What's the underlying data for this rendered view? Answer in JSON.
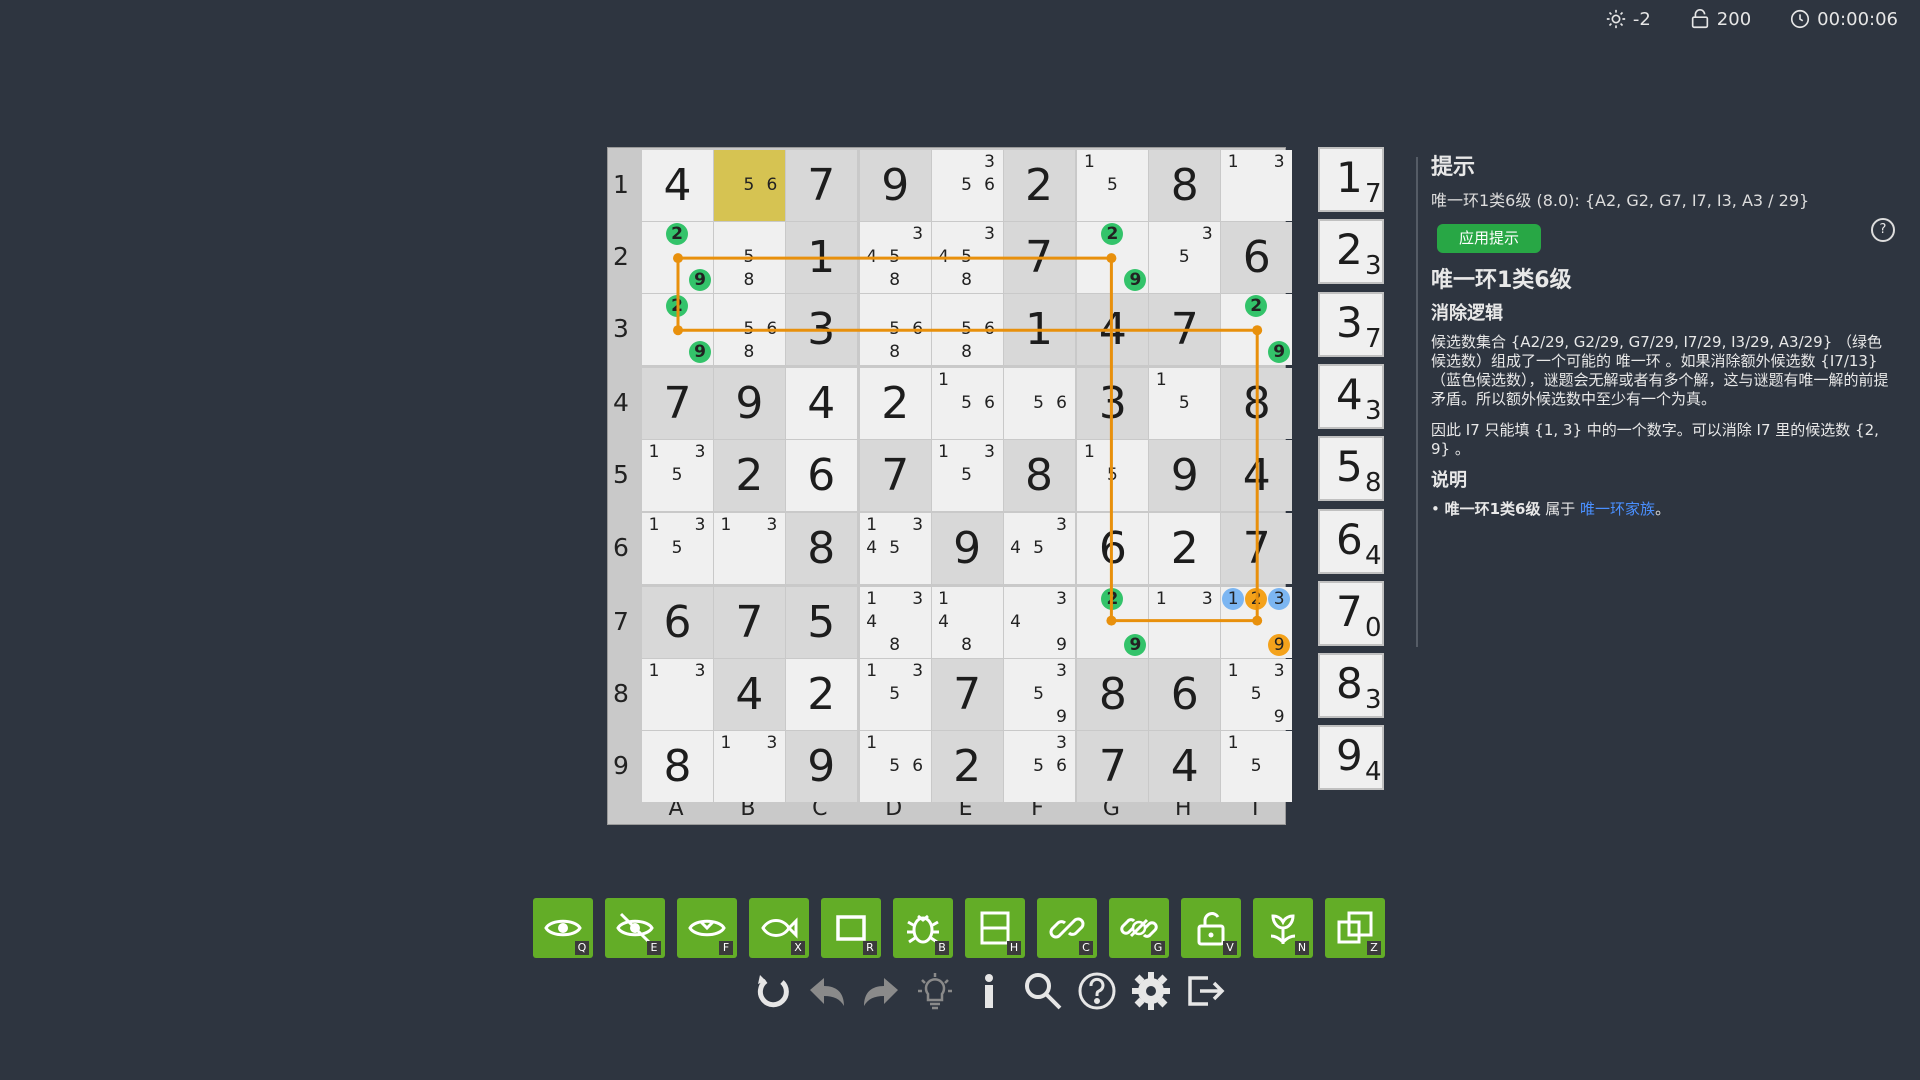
{
  "status": {
    "light": "-2",
    "score": "200",
    "time": "00:00:06"
  },
  "board": {
    "row_labels": [
      "1",
      "2",
      "3",
      "4",
      "5",
      "6",
      "7",
      "8",
      "9"
    ],
    "col_labels": [
      "A",
      "B",
      "C",
      "D",
      "E",
      "F",
      "G",
      "H",
      "I"
    ],
    "highlight": "B1",
    "cells": {
      "A1": {
        "v": "4",
        "g": 0
      },
      "B1": {
        "c": [
          "5",
          "6"
        ]
      },
      "C1": {
        "v": "7",
        "g": 1
      },
      "D1": {
        "v": "9",
        "g": 1
      },
      "E1": {
        "c": [
          "3",
          "5",
          "6"
        ]
      },
      "F1": {
        "v": "2",
        "g": 1
      },
      "G1": {
        "c": [
          "1",
          "5"
        ]
      },
      "H1": {
        "v": "8",
        "g": 1
      },
      "I1": {
        "c": [
          "1",
          "3"
        ]
      },
      "A2": {
        "c": [
          "2",
          "9"
        ],
        "green": [
          "2",
          "9"
        ]
      },
      "B2": {
        "c": [
          "5",
          "8"
        ]
      },
      "C2": {
        "v": "1",
        "g": 1
      },
      "D2": {
        "c": [
          "3",
          "4",
          "5",
          "8"
        ]
      },
      "E2": {
        "c": [
          "3",
          "4",
          "5",
          "8"
        ]
      },
      "F2": {
        "v": "7",
        "g": 1
      },
      "G2": {
        "c": [
          "2",
          "9"
        ],
        "green": [
          "2",
          "9"
        ]
      },
      "H2": {
        "c": [
          "3",
          "5"
        ]
      },
      "I2": {
        "v": "6",
        "g": 1
      },
      "A3": {
        "c": [
          "2",
          "9"
        ],
        "green": [
          "2",
          "9"
        ]
      },
      "B3": {
        "c": [
          "5",
          "6",
          "8"
        ]
      },
      "C3": {
        "v": "3",
        "g": 1
      },
      "D3": {
        "c": [
          "5",
          "6",
          "8"
        ]
      },
      "E3": {
        "c": [
          "5",
          "6",
          "8"
        ]
      },
      "F3": {
        "v": "1",
        "g": 1
      },
      "G3": {
        "v": "4",
        "g": 1
      },
      "H3": {
        "v": "7",
        "g": 1
      },
      "I3": {
        "c": [
          "2",
          "9"
        ],
        "green": [
          "2",
          "9"
        ]
      },
      "A4": {
        "v": "7",
        "g": 1
      },
      "B4": {
        "v": "9",
        "g": 1
      },
      "C4": {
        "v": "4",
        "g": 0
      },
      "D4": {
        "v": "2",
        "g": 0
      },
      "E4": {
        "c": [
          "1",
          "5",
          "6"
        ]
      },
      "F4": {
        "c": [
          "5",
          "6"
        ]
      },
      "G4": {
        "v": "3",
        "g": 1
      },
      "H4": {
        "c": [
          "1",
          "5"
        ]
      },
      "I4": {
        "v": "8",
        "g": 1
      },
      "A5": {
        "c": [
          "1",
          "3",
          "5"
        ]
      },
      "B5": {
        "v": "2",
        "g": 1
      },
      "C5": {
        "v": "6",
        "g": 0
      },
      "D5": {
        "v": "7",
        "g": 1
      },
      "E5": {
        "c": [
          "1",
          "3",
          "5"
        ]
      },
      "F5": {
        "v": "8",
        "g": 1
      },
      "G5": {
        "c": [
          "1",
          "5"
        ]
      },
      "H5": {
        "v": "9",
        "g": 1
      },
      "I5": {
        "v": "4",
        "g": 1
      },
      "A6": {
        "c": [
          "1",
          "3",
          "5"
        ]
      },
      "B6": {
        "c": [
          "1",
          "3"
        ]
      },
      "C6": {
        "v": "8",
        "g": 1
      },
      "D6": {
        "c": [
          "1",
          "3",
          "4",
          "5"
        ]
      },
      "E6": {
        "v": "9",
        "g": 1
      },
      "F6": {
        "c": [
          "3",
          "4",
          "5"
        ]
      },
      "G6": {
        "v": "6",
        "g": 0
      },
      "H6": {
        "v": "2",
        "g": 0
      },
      "I6": {
        "v": "7",
        "g": 1
      },
      "A7": {
        "v": "6",
        "g": 1
      },
      "B7": {
        "v": "7",
        "g": 1
      },
      "C7": {
        "v": "5",
        "g": 1
      },
      "D7": {
        "c": [
          "1",
          "3",
          "4",
          "8"
        ]
      },
      "E7": {
        "c": [
          "1",
          "4",
          "8"
        ]
      },
      "F7": {
        "c": [
          "3",
          "4",
          "9"
        ]
      },
      "G7": {
        "c": [
          "2",
          "9"
        ],
        "green": [
          "2",
          "9"
        ]
      },
      "H7": {
        "c": [
          "1",
          "3"
        ]
      },
      "I7": {
        "c": [
          "1",
          "2",
          "3",
          "9"
        ],
        "blue": [
          "1",
          "3"
        ],
        "orange": [
          "2",
          "9"
        ]
      },
      "A8": {
        "c": [
          "1",
          "3"
        ]
      },
      "B8": {
        "v": "4",
        "g": 1
      },
      "C8": {
        "v": "2",
        "g": 0
      },
      "D8": {
        "c": [
          "1",
          "3",
          "5"
        ]
      },
      "E8": {
        "v": "7",
        "g": 1
      },
      "F8": {
        "c": [
          "3",
          "5",
          "9"
        ]
      },
      "G8": {
        "v": "8",
        "g": 1
      },
      "H8": {
        "v": "6",
        "g": 1
      },
      "I8": {
        "c": [
          "1",
          "3",
          "5",
          "9"
        ]
      },
      "A9": {
        "v": "8",
        "g": 0
      },
      "B9": {
        "c": [
          "1",
          "3"
        ]
      },
      "C9": {
        "v": "9",
        "g": 1
      },
      "D9": {
        "c": [
          "1",
          "5",
          "6"
        ]
      },
      "E9": {
        "v": "2",
        "g": 1
      },
      "F9": {
        "c": [
          "3",
          "5",
          "6"
        ]
      },
      "G9": {
        "v": "7",
        "g": 1
      },
      "H9": {
        "v": "4",
        "g": 1
      },
      "I9": {
        "c": [
          "1",
          "5"
        ]
      }
    },
    "loop": [
      "A2",
      "G2",
      "G7",
      "I7",
      "I3",
      "A3"
    ]
  },
  "digit_counts": [
    {
      "digit": "1",
      "count": "7"
    },
    {
      "digit": "2",
      "count": "3"
    },
    {
      "digit": "3",
      "count": "7"
    },
    {
      "digit": "4",
      "count": "3"
    },
    {
      "digit": "5",
      "count": "8"
    },
    {
      "digit": "6",
      "count": "4"
    },
    {
      "digit": "7",
      "count": "0"
    },
    {
      "digit": "8",
      "count": "3"
    },
    {
      "digit": "9",
      "count": "4"
    }
  ],
  "hint": {
    "title": "提示",
    "summary": "唯一环1类6级 (8.0): {A2, G2, G7, I7, I3, A3 / 29}",
    "apply_label": "应用提示",
    "technique": "唯一环1类6级",
    "logic_title": "消除逻辑",
    "logic_p1": "候选数集合 {A2/29, G2/29, G7/29, I7/29, I3/29, A3/29} （绿色候选数）组成了一个可能的 唯一环 。如果消除额外候选数 {I7/13} （蓝色候选数），谜题会无解或者有多个解，这与谜题有唯一解的前提矛盾。所以额外候选数中至少有一个为真。",
    "logic_p2": "因此 I7 只能填 {1, 3} 中的一个数字。可以消除 I7 里的候选数 {2, 9} 。",
    "explain_title": "说明",
    "explain_item_bold": "唯一环1类6级",
    "explain_item_mid": " 属于 ",
    "explain_item_link": "唯一环家族",
    "explain_item_end": "。"
  },
  "tools": [
    {
      "name": "eye",
      "key": "Q"
    },
    {
      "name": "eye-off",
      "key": "E"
    },
    {
      "name": "eye-fish",
      "key": "F"
    },
    {
      "name": "fish",
      "key": "X"
    },
    {
      "name": "rectangle",
      "key": "R"
    },
    {
      "name": "bug",
      "key": "B"
    },
    {
      "name": "house",
      "key": "H"
    },
    {
      "name": "chain",
      "key": "C"
    },
    {
      "name": "chain-group",
      "key": "G"
    },
    {
      "name": "unlock",
      "key": "V"
    },
    {
      "name": "flower",
      "key": "N"
    },
    {
      "name": "copy",
      "key": "Z"
    }
  ],
  "accent": "#63ad27",
  "loop_color": "#e8900c"
}
